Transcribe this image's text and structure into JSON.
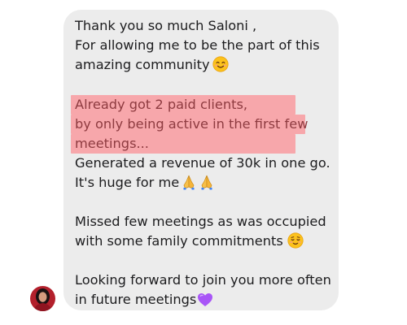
{
  "message": {
    "lines": {
      "l1": "Thank you so much Saloni ,",
      "l2": "For allowing me to be the part of this",
      "l3": "amazing community",
      "l4": "Already got 2 paid clients,",
      "l5": "by only being active in the first few",
      "l6": "meetings...",
      "l7": "Generated a revenue of 30k in one go.",
      "l8": "It's huge for me",
      "l9": "Missed few meetings as was occupied",
      "l10": "with some family commitments",
      "l11": "Looking forward to join you more often",
      "l12": "in future meetings"
    },
    "icons": {
      "smile": "smiling-face-icon",
      "pray": "folded-hands-icon",
      "relieved": "relieved-face-icon",
      "heart": "purple-heart-icon"
    }
  },
  "colors": {
    "bubble": "#ececec",
    "text": "#1c1c1e",
    "highlight": "#f7a7ab",
    "highlight_text": "#8e3b40",
    "heart": "#a855f7"
  }
}
